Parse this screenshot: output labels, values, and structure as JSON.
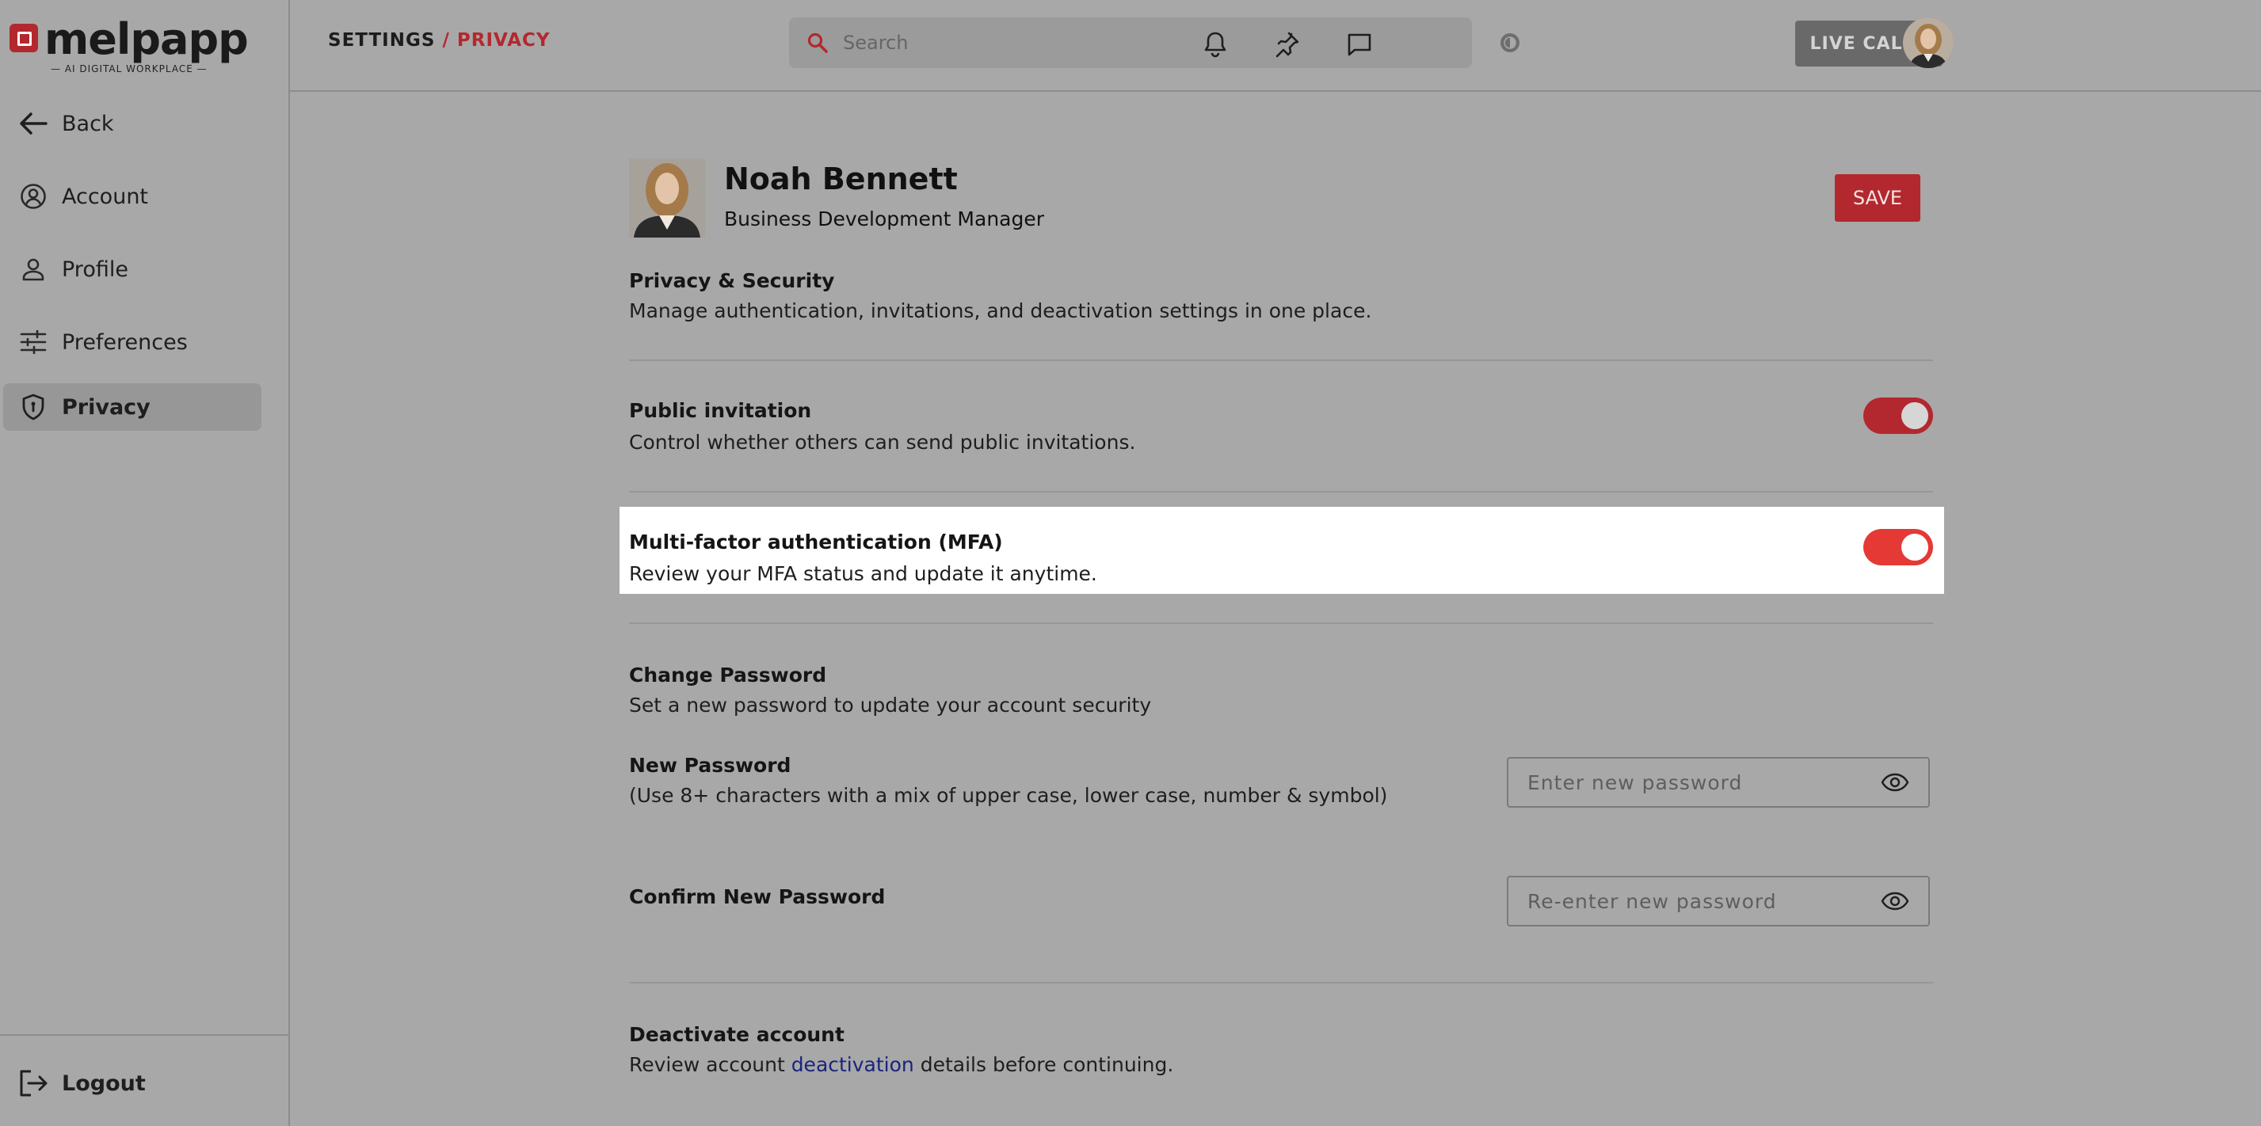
{
  "app": {
    "logo_text": "melpapp",
    "logo_tagline": "— AI DIGITAL WORKPLACE —"
  },
  "sidebar": {
    "back_label": "Back",
    "items": [
      {
        "label": "Account",
        "icon": "account-circle-icon"
      },
      {
        "label": "Profile",
        "icon": "person-icon"
      },
      {
        "label": "Preferences",
        "icon": "sliders-icon"
      },
      {
        "label": "Privacy",
        "icon": "shield-icon",
        "active": true
      }
    ],
    "logout_label": "Logout"
  },
  "header": {
    "breadcrumb_root": "SETTINGS",
    "breadcrumb_sep": "/",
    "breadcrumb_current": "PRIVACY",
    "search_placeholder": "Search",
    "live_calls_label": "LIVE CALLS"
  },
  "profile": {
    "name": "Noah Bennett",
    "role": "Business Development Manager",
    "save_label": "SAVE"
  },
  "privacy": {
    "title": "Privacy & Security",
    "description": "Manage authentication, invitations, and deactivation settings in one place.",
    "public_invitation": {
      "title": "Public invitation",
      "description": "Control whether others can send public invitations.",
      "enabled": true
    },
    "mfa": {
      "title": "Multi-factor authentication (MFA)",
      "description": "Review your MFA status and update it anytime.",
      "enabled": true
    },
    "change_password": {
      "title": "Change Password",
      "description": "Set a new password to update your account security",
      "new_label": "New Password",
      "new_hint": "(Use 8+ characters with a mix of upper case, lower case, number & symbol)",
      "new_placeholder": "Enter new password",
      "confirm_label": "Confirm New Password",
      "confirm_placeholder": "Re-enter new password"
    },
    "deactivate": {
      "title": "Deactivate account",
      "text_before": "Review account ",
      "link": "deactivation",
      "text_after": " details before continuing."
    }
  },
  "colors": {
    "accent": "#b3282e",
    "toggle_on": "#e53935",
    "link": "#1a237e"
  }
}
